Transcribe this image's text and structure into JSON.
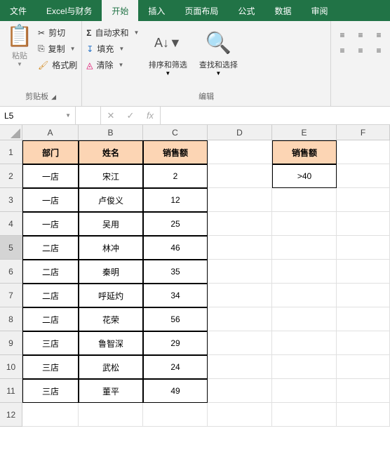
{
  "tabs": [
    "文件",
    "Excel与财务",
    "开始",
    "插入",
    "页面布局",
    "公式",
    "数据",
    "审阅"
  ],
  "active_tab": 2,
  "ribbon": {
    "clipboard": {
      "title": "剪贴板",
      "paste": "粘贴",
      "cut": "剪切",
      "copy": "复制",
      "format_painter": "格式刷"
    },
    "editing": {
      "title": "编辑",
      "autosum": "自动求和",
      "fill": "填充",
      "clear": "清除",
      "sort_filter": "排序和筛选",
      "find_select": "查找和选择"
    }
  },
  "namebox": "L5",
  "columns": [
    "A",
    "B",
    "C",
    "D",
    "E",
    "F"
  ],
  "rows_count": 12,
  "active_row": 5,
  "table_headers": {
    "dept": "部门",
    "name": "姓名",
    "sales": "销售额"
  },
  "table_data": [
    {
      "dept": "一店",
      "name": "宋江",
      "sales": "2"
    },
    {
      "dept": "一店",
      "name": "卢俊义",
      "sales": "12"
    },
    {
      "dept": "一店",
      "name": "吴用",
      "sales": "25"
    },
    {
      "dept": "二店",
      "name": "林冲",
      "sales": "46"
    },
    {
      "dept": "二店",
      "name": "秦明",
      "sales": "35"
    },
    {
      "dept": "二店",
      "name": "呼延灼",
      "sales": "34"
    },
    {
      "dept": "二店",
      "name": "花荣",
      "sales": "56"
    },
    {
      "dept": "三店",
      "name": "鲁智深",
      "sales": "29"
    },
    {
      "dept": "三店",
      "name": "武松",
      "sales": "24"
    },
    {
      "dept": "三店",
      "name": "董平",
      "sales": "49"
    }
  ],
  "criteria": {
    "header": "销售额",
    "value": ">40"
  }
}
